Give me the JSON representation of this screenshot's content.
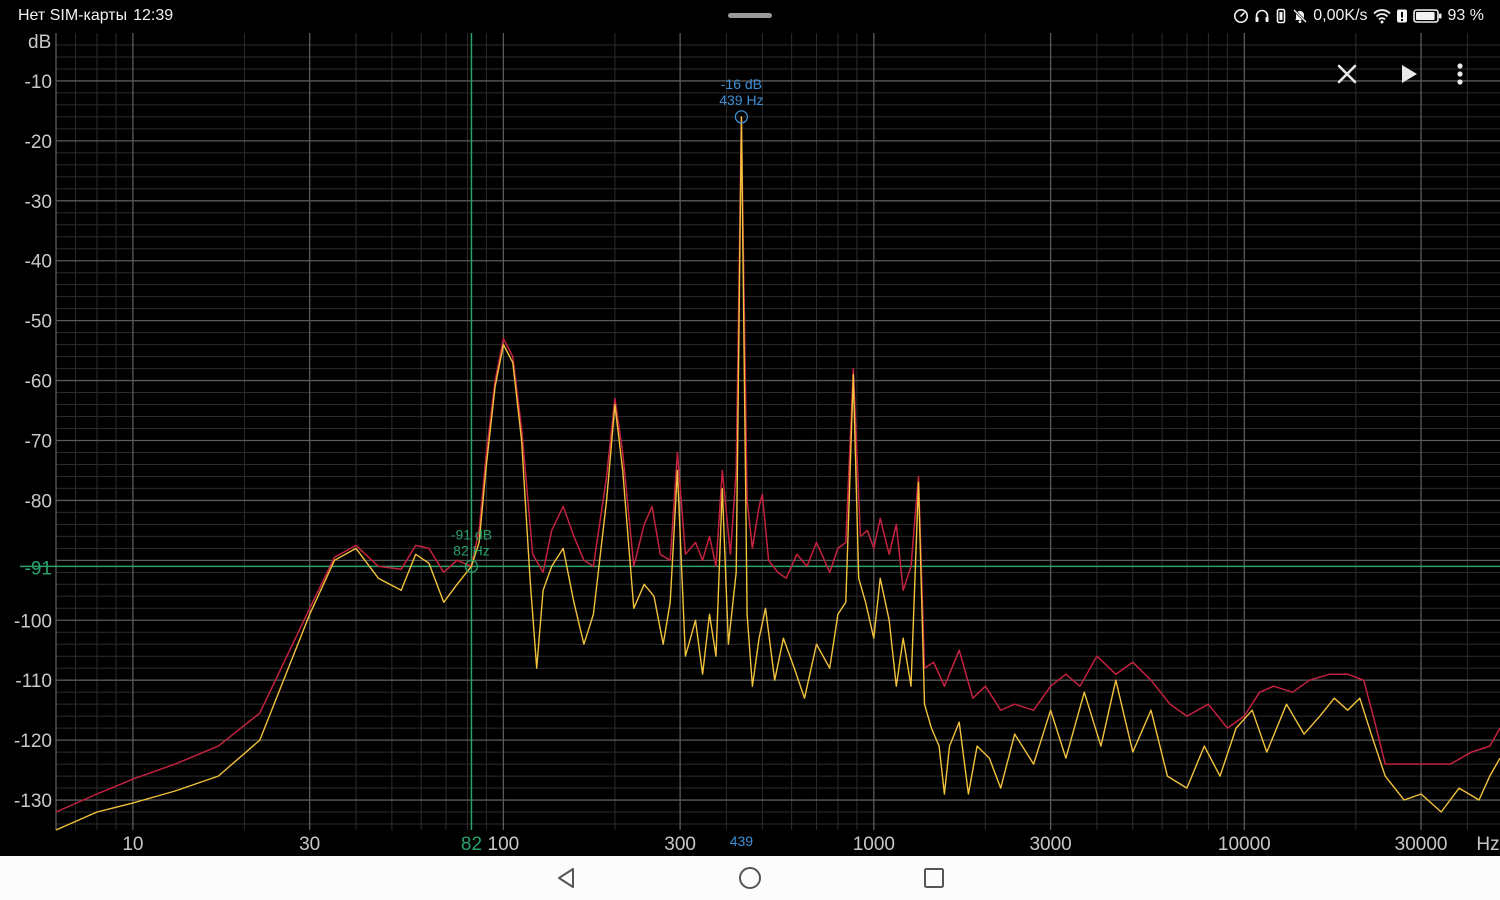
{
  "status_bar": {
    "carrier": "Нет SIM-карты",
    "time": "12:39",
    "net_speed": "0,00K/s",
    "battery": "93 %",
    "battery_level": 0.93
  },
  "toolbar": {
    "close_icon": "close-icon",
    "play_icon": "play-icon",
    "menu_icon": "more-vert-icon"
  },
  "nav_bar": {
    "back_icon": "back-triangle-icon",
    "home_icon": "home-circle-icon",
    "recents_icon": "recents-square-icon"
  },
  "colors": {
    "background": "#000000",
    "grid_major": "#5a5a5a",
    "grid_minor": "#2c2c2c",
    "axis_text": "#c8c8c8",
    "peak_hold": "#c3223f",
    "live_spectrum": "#f2c23c",
    "peak_marker": "#3e8fd6",
    "cursor": "#2aa16b"
  },
  "chart_data": {
    "type": "line",
    "ylabel": "dB",
    "xlabel": "Hz",
    "x_scale": "log",
    "xlim": [
      6.2,
      49000
    ],
    "ylim": [
      -135,
      -2
    ],
    "grid": true,
    "y_ticks": [
      -10,
      -20,
      -30,
      -40,
      -50,
      -60,
      -70,
      -80,
      -100,
      -110,
      -120,
      -130
    ],
    "x_ticks": [
      {
        "value": 10,
        "label": "10"
      },
      {
        "value": 30,
        "label": "30"
      },
      {
        "value": 100,
        "label": "100"
      },
      {
        "value": 300,
        "label": "300"
      },
      {
        "value": 1000,
        "label": "1000"
      },
      {
        "value": 3000,
        "label": "3000"
      },
      {
        "value": 10000,
        "label": "10000"
      },
      {
        "value": 30000,
        "label": "30000"
      }
    ],
    "peak_marker": {
      "freq": 439,
      "db": -16,
      "label_db": "-16 dB",
      "label_hz": "439 Hz",
      "axis_label": "439"
    },
    "cursor": {
      "freq": 82,
      "db": -91,
      "label_db": "-91 dB",
      "label_hz": "82 Hz",
      "axis_label_x": "82",
      "axis_label_y": "-91"
    },
    "peaks": [
      {
        "f": 100,
        "db": -53
      },
      {
        "f": 200,
        "db": -63
      },
      {
        "f": 295,
        "db": -72
      },
      {
        "f": 390,
        "db": -75
      },
      {
        "f": 439,
        "db": -16
      },
      {
        "f": 880,
        "db": -58
      },
      {
        "f": 1320,
        "db": -76
      }
    ],
    "series": [
      {
        "key": "peak_hold",
        "points": [
          [
            6.2,
            -132
          ],
          [
            8,
            -129
          ],
          [
            10,
            -126.5
          ],
          [
            13,
            -124
          ],
          [
            17,
            -121
          ],
          [
            22,
            -115.5
          ],
          [
            30,
            -98
          ],
          [
            35,
            -89.5
          ],
          [
            40,
            -87.5
          ],
          [
            46,
            -91
          ],
          [
            53,
            -91.5
          ],
          [
            58,
            -87.5
          ],
          [
            63,
            -88
          ],
          [
            69,
            -92
          ],
          [
            75,
            -90
          ],
          [
            82,
            -91
          ],
          [
            86,
            -85
          ],
          [
            90,
            -72
          ],
          [
            95,
            -60
          ],
          [
            100,
            -53
          ],
          [
            106,
            -56
          ],
          [
            112,
            -68
          ],
          [
            120,
            -89
          ],
          [
            128,
            -92
          ],
          [
            135,
            -85
          ],
          [
            145,
            -81
          ],
          [
            155,
            -86
          ],
          [
            165,
            -90
          ],
          [
            175,
            -91
          ],
          [
            190,
            -76
          ],
          [
            200,
            -63
          ],
          [
            210,
            -72
          ],
          [
            225,
            -91
          ],
          [
            240,
            -84
          ],
          [
            252,
            -81
          ],
          [
            265,
            -89
          ],
          [
            282,
            -90
          ],
          [
            295,
            -72
          ],
          [
            310,
            -89
          ],
          [
            330,
            -87
          ],
          [
            345,
            -90
          ],
          [
            360,
            -86
          ],
          [
            375,
            -91
          ],
          [
            390,
            -75
          ],
          [
            410,
            -89
          ],
          [
            425,
            -75
          ],
          [
            439,
            -16
          ],
          [
            455,
            -80
          ],
          [
            470,
            -88
          ],
          [
            490,
            -81
          ],
          [
            500,
            -79
          ],
          [
            520,
            -90
          ],
          [
            550,
            -92
          ],
          [
            580,
            -93
          ],
          [
            620,
            -89
          ],
          [
            660,
            -91
          ],
          [
            700,
            -87
          ],
          [
            760,
            -92
          ],
          [
            800,
            -88
          ],
          [
            840,
            -87
          ],
          [
            880,
            -58
          ],
          [
            920,
            -86
          ],
          [
            960,
            -85
          ],
          [
            1000,
            -88
          ],
          [
            1040,
            -83
          ],
          [
            1100,
            -89
          ],
          [
            1150,
            -84
          ],
          [
            1200,
            -95
          ],
          [
            1260,
            -91
          ],
          [
            1320,
            -76
          ],
          [
            1370,
            -108
          ],
          [
            1450,
            -107
          ],
          [
            1550,
            -111
          ],
          [
            1700,
            -105
          ],
          [
            1850,
            -113
          ],
          [
            2000,
            -111
          ],
          [
            2200,
            -115
          ],
          [
            2400,
            -114
          ],
          [
            2700,
            -115
          ],
          [
            3000,
            -111
          ],
          [
            3300,
            -109
          ],
          [
            3600,
            -111
          ],
          [
            4000,
            -106
          ],
          [
            4500,
            -109
          ],
          [
            5000,
            -107
          ],
          [
            5600,
            -110
          ],
          [
            6300,
            -114
          ],
          [
            7000,
            -116
          ],
          [
            8000,
            -114
          ],
          [
            9000,
            -118
          ],
          [
            10000,
            -116
          ],
          [
            11000,
            -112
          ],
          [
            12000,
            -111
          ],
          [
            13500,
            -112
          ],
          [
            15000,
            -110
          ],
          [
            17000,
            -109
          ],
          [
            19000,
            -109
          ],
          [
            21000,
            -110
          ],
          [
            22500,
            -117
          ],
          [
            24000,
            -124
          ],
          [
            27000,
            -124
          ],
          [
            31000,
            -124
          ],
          [
            36000,
            -124
          ],
          [
            41000,
            -122
          ],
          [
            46000,
            -121
          ],
          [
            49000,
            -118
          ]
        ]
      },
      {
        "key": "live_spectrum",
        "points": [
          [
            6.2,
            -135
          ],
          [
            8,
            -132
          ],
          [
            10,
            -130.5
          ],
          [
            13,
            -128.5
          ],
          [
            17,
            -126
          ],
          [
            22,
            -120
          ],
          [
            30,
            -99
          ],
          [
            35,
            -90
          ],
          [
            40,
            -88
          ],
          [
            46,
            -93
          ],
          [
            53,
            -95
          ],
          [
            58,
            -89
          ],
          [
            63,
            -90.5
          ],
          [
            69,
            -97
          ],
          [
            75,
            -94
          ],
          [
            82,
            -91
          ],
          [
            86,
            -87
          ],
          [
            90,
            -74
          ],
          [
            95,
            -61
          ],
          [
            100,
            -54
          ],
          [
            106,
            -57
          ],
          [
            112,
            -70
          ],
          [
            118,
            -93
          ],
          [
            123,
            -108
          ],
          [
            128,
            -95
          ],
          [
            135,
            -91
          ],
          [
            145,
            -88
          ],
          [
            155,
            -97
          ],
          [
            165,
            -104
          ],
          [
            175,
            -99
          ],
          [
            190,
            -80
          ],
          [
            200,
            -64
          ],
          [
            210,
            -75
          ],
          [
            225,
            -98
          ],
          [
            240,
            -94
          ],
          [
            255,
            -96
          ],
          [
            270,
            -104
          ],
          [
            282,
            -97
          ],
          [
            295,
            -75
          ],
          [
            310,
            -106
          ],
          [
            330,
            -100
          ],
          [
            345,
            -109
          ],
          [
            360,
            -99
          ],
          [
            375,
            -106
          ],
          [
            390,
            -78
          ],
          [
            405,
            -104
          ],
          [
            425,
            -92
          ],
          [
            439,
            -16
          ],
          [
            455,
            -99
          ],
          [
            470,
            -111
          ],
          [
            490,
            -103
          ],
          [
            510,
            -98
          ],
          [
            540,
            -110
          ],
          [
            570,
            -103
          ],
          [
            610,
            -108
          ],
          [
            650,
            -113
          ],
          [
            700,
            -104
          ],
          [
            760,
            -108
          ],
          [
            800,
            -99
          ],
          [
            840,
            -97
          ],
          [
            880,
            -59
          ],
          [
            910,
            -93
          ],
          [
            950,
            -97
          ],
          [
            1000,
            -103
          ],
          [
            1040,
            -93
          ],
          [
            1100,
            -100
          ],
          [
            1150,
            -111
          ],
          [
            1200,
            -103
          ],
          [
            1260,
            -111
          ],
          [
            1320,
            -77
          ],
          [
            1370,
            -114
          ],
          [
            1430,
            -118
          ],
          [
            1500,
            -121
          ],
          [
            1550,
            -129
          ],
          [
            1600,
            -121
          ],
          [
            1700,
            -117
          ],
          [
            1800,
            -129
          ],
          [
            1900,
            -121
          ],
          [
            2050,
            -123
          ],
          [
            2200,
            -128
          ],
          [
            2400,
            -119
          ],
          [
            2700,
            -124
          ],
          [
            3000,
            -115
          ],
          [
            3300,
            -123
          ],
          [
            3700,
            -112
          ],
          [
            4100,
            -121
          ],
          [
            4500,
            -110
          ],
          [
            5000,
            -122
          ],
          [
            5600,
            -115
          ],
          [
            6200,
            -126
          ],
          [
            7000,
            -128
          ],
          [
            7800,
            -121
          ],
          [
            8600,
            -126
          ],
          [
            9500,
            -118
          ],
          [
            10500,
            -115
          ],
          [
            11500,
            -122
          ],
          [
            13000,
            -114
          ],
          [
            14500,
            -119
          ],
          [
            16000,
            -116
          ],
          [
            17500,
            -113
          ],
          [
            19000,
            -115
          ],
          [
            20500,
            -113
          ],
          [
            22000,
            -119
          ],
          [
            24000,
            -126
          ],
          [
            27000,
            -130
          ],
          [
            30000,
            -129
          ],
          [
            34000,
            -132
          ],
          [
            38000,
            -128
          ],
          [
            43000,
            -130
          ],
          [
            46000,
            -126
          ],
          [
            49000,
            -123
          ]
        ]
      }
    ]
  }
}
